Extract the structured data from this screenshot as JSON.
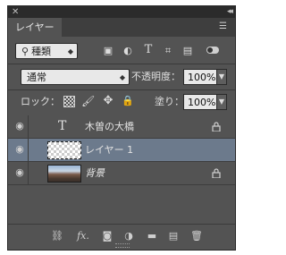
{
  "panel": {
    "tab_label": "レイヤー"
  },
  "filter": {
    "kind_label": "種類"
  },
  "blend": {
    "mode": "通常",
    "opacity_label": "不透明度：",
    "opacity_value": "100%"
  },
  "lock": {
    "label": "ロック：",
    "fill_label": "塗り：",
    "fill_value": "100%"
  },
  "layers": [
    {
      "name": "木曽の大橋",
      "type": "text",
      "selected": false,
      "locked": true
    },
    {
      "name": "レイヤー 1",
      "type": "pixel",
      "selected": true,
      "locked": false
    },
    {
      "name": "背景",
      "type": "background",
      "selected": false,
      "locked": true
    }
  ],
  "icons": {
    "close": "close-icon",
    "collapse": "collapse-icon",
    "menu": "panel-menu-icon",
    "visibility": "eye-icon",
    "lock": "lock-icon"
  }
}
